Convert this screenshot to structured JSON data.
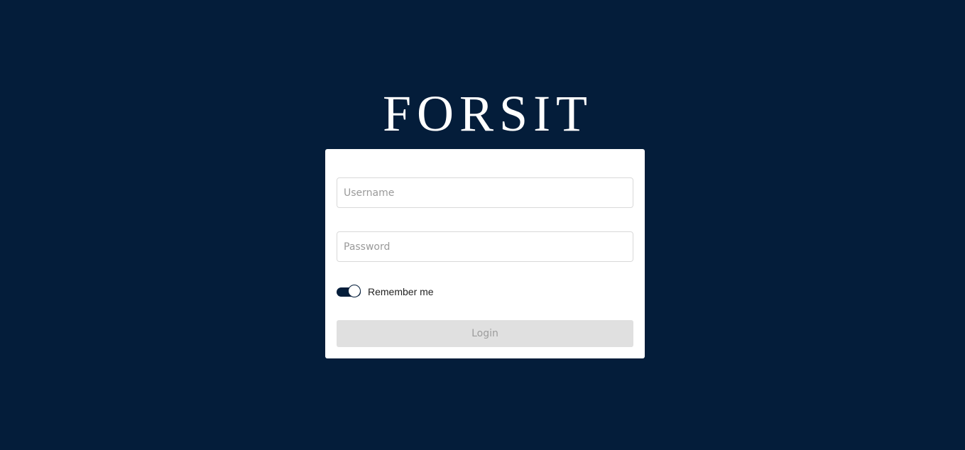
{
  "brand": {
    "logo_text": "FORSIT"
  },
  "login_form": {
    "username": {
      "placeholder": "Username",
      "value": ""
    },
    "password": {
      "placeholder": "Password",
      "value": ""
    },
    "remember_me": {
      "label": "Remember me",
      "checked": true
    },
    "login_label": "Login",
    "login_disabled": true
  },
  "colors": {
    "background": "#041d3a",
    "card": "#ffffff",
    "toggle_on": "#041d3a",
    "button_disabled_bg": "#e0e0e0",
    "button_disabled_text": "#9c9c9c"
  }
}
